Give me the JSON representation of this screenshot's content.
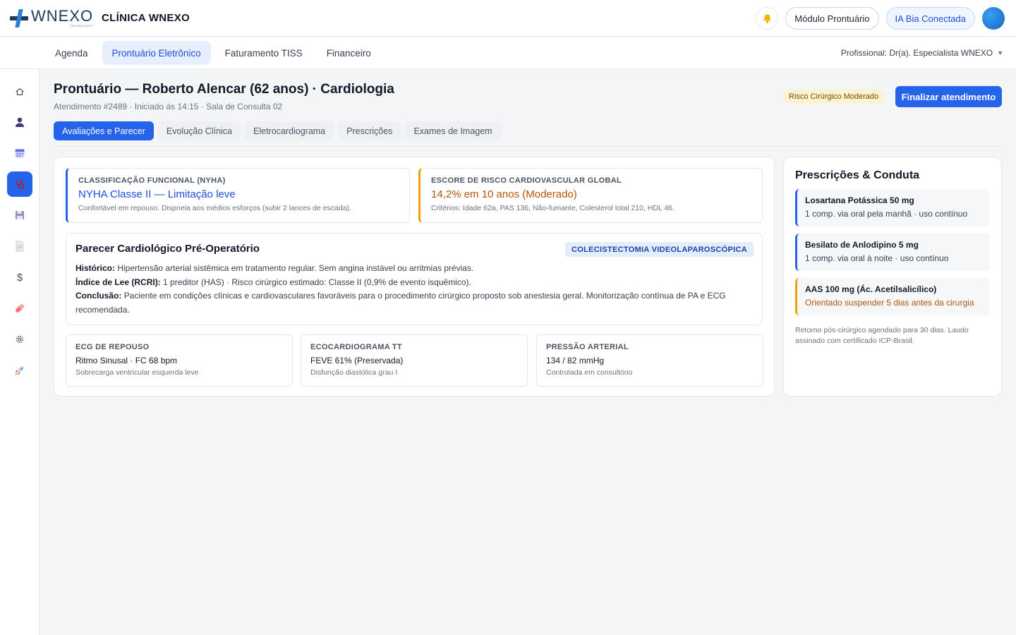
{
  "header": {
    "logo_word": "WNEXO",
    "logo_sub": "TECHNOLOGY",
    "clinic": "CLÍNICA WNEXO",
    "module_btn": "Módulo Prontuário",
    "ia_btn": "IA Bia Conectada"
  },
  "nav": {
    "tabs": [
      {
        "label": "Agenda"
      },
      {
        "label": "Prontuário Eletrônico"
      },
      {
        "label": "Faturamento TISS"
      },
      {
        "label": "Financeiro"
      }
    ],
    "professional": "Profissional: Dr(a). Especialista WNEXO"
  },
  "sidebar": {
    "icons": [
      "home-icon",
      "user-icon",
      "calendar-icon",
      "stethoscope-icon",
      "save-icon",
      "document-icon",
      "dollar-icon",
      "pill-icon",
      "gear-icon",
      "rocket-icon"
    ]
  },
  "page": {
    "title": "Prontuário — Roberto Alencar (62 anos) · Cardiologia",
    "subtitle": "Atendimento #2489 · Iniciado às 14:15 · Sala de Consulta 02",
    "risk_badge": "Risco Cirúrgico Moderado",
    "finish_btn": "Finalizar atendimento",
    "accent": "#2563eb"
  },
  "subtabs": [
    {
      "label": "Avaliações e Parecer"
    },
    {
      "label": "Evolução Clínica"
    },
    {
      "label": "Eletrocardiograma"
    },
    {
      "label": "Prescrições"
    },
    {
      "label": "Exames de Imagem"
    }
  ],
  "metrics": [
    {
      "label": "CLASSIFICAÇÃO FUNCIONAL (NYHA)",
      "value": "NYHA Classe II — Limitação leve",
      "note": "Confortável em repouso. Dispneia aos médios esforços (subir 2 lances de escada)."
    },
    {
      "label": "ESCORE DE RISCO CARDIOVASCULAR GLOBAL",
      "value": "14,2% em 10 anos (Moderado)",
      "note": "Critérios: Idade 62a, PAS 136, Não-fumante, Colesterol total 210, HDL 46."
    }
  ],
  "parecer": {
    "title": "Parecer Cardiológico Pré-Operatório",
    "tag": "COLECISTECTOMIA VIDEOLAPAROSCÓPICA",
    "historico_label": "Histórico:",
    "historico": " Hipertensão arterial sistêmica em tratamento regular. Sem angina instável ou arritmias prévias.",
    "lee_label": "Índice de Lee (RCRI):",
    "lee": " 1 preditor (HAS) · Risco cirúrgico estimado: Classe II (0,9% de evento isquêmico).",
    "conclusao_label": "Conclusão:",
    "conclusao": " Paciente em condições clínicas e cardiovasculares favoráveis para o procedimento cirúrgico proposto sob anestesia geral. Monitorização contínua de PA e ECG recomendada."
  },
  "exams": [
    {
      "label": "ECG DE REPOUSO",
      "value": "Ritmo Sinusal · FC 68 bpm",
      "note": "Sobrecarga ventricular esquerda leve"
    },
    {
      "label": "ECOCARDIOGRAMA TT",
      "value": "FEVE 61% (Preservada)",
      "note": "Disfunção diastólica grau I"
    },
    {
      "label": "PRESSÃO ARTERIAL",
      "value": "134 / 82 mmHg",
      "note": "Controlada em consultório"
    }
  ],
  "prescriptions": {
    "title": "Prescrições & Conduta",
    "items": [
      {
        "name": "Losartana Potássica 50 mg",
        "dose": "1 comp. via oral pela manhã · uso contínuo"
      },
      {
        "name": "Besilato de Anlodipino 5 mg",
        "dose": "1 comp. via oral à noite · uso contínuo"
      },
      {
        "name": "AAS 100 mg (Ác. Acetilsalicílico)",
        "dose": "Orientado suspender 5 dias antes da cirurgia"
      }
    ],
    "note": "Retorno pós-cirúrgico agendado para 30 dias. Laudo assinado com certificado ICP-Brasil."
  }
}
